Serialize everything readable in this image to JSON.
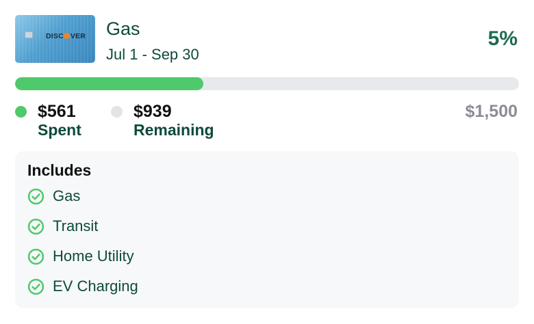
{
  "card": {
    "brand": "DISCOVER",
    "badge": "it",
    "brand_color": "#f58220"
  },
  "category": {
    "title": "Gas",
    "dates": "Jul 1 - Sep 30",
    "rate": "5%"
  },
  "progress": {
    "spent_fraction": 0.374,
    "fill_color": "#4ec96b",
    "track_color": "#e8e9ec"
  },
  "summary": {
    "spent_amount": "$561",
    "spent_label": "Spent",
    "remaining_amount": "$939",
    "remaining_label": "Remaining",
    "total": "$1,500"
  },
  "includes": {
    "title": "Includes",
    "icon": "check-circle-icon",
    "items": [
      "Gas",
      "Transit",
      "Home Utility",
      "EV Charging"
    ]
  }
}
